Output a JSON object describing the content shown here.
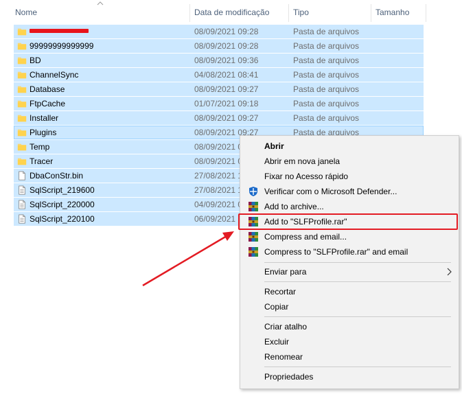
{
  "columns": {
    "name": "Nome",
    "date": "Data de modificação",
    "type": "Tipo",
    "size": "Tamanho"
  },
  "files": [
    {
      "name": "",
      "redacted": true,
      "date": "08/09/2021 09:28",
      "type": "Pasta de arquivos",
      "icon": "folder-icon"
    },
    {
      "name": "99999999999999",
      "date": "08/09/2021 09:28",
      "type": "Pasta de arquivos",
      "icon": "folder-icon"
    },
    {
      "name": "BD",
      "date": "08/09/2021 09:36",
      "type": "Pasta de arquivos",
      "icon": "folder-icon"
    },
    {
      "name": "ChannelSync",
      "date": "04/08/2021 08:41",
      "type": "Pasta de arquivos",
      "icon": "folder-icon"
    },
    {
      "name": "Database",
      "date": "08/09/2021 09:27",
      "type": "Pasta de arquivos",
      "icon": "folder-icon"
    },
    {
      "name": "FtpCache",
      "date": "01/07/2021 09:18",
      "type": "Pasta de arquivos",
      "icon": "folder-icon"
    },
    {
      "name": "Installer",
      "date": "08/09/2021 09:27",
      "type": "Pasta de arquivos",
      "icon": "folder-icon"
    },
    {
      "name": "Plugins",
      "date": "08/09/2021 09:27",
      "type": "Pasta de arquivos",
      "icon": "folder-icon"
    },
    {
      "name": "Temp",
      "date": "08/09/2021 0",
      "type": "",
      "icon": "folder-icon"
    },
    {
      "name": "Tracer",
      "date": "08/09/2021 0",
      "type": "",
      "icon": "folder-icon"
    },
    {
      "name": "DbaConStr.bin",
      "date": "27/08/2021 1",
      "type": "",
      "icon": "file-icon"
    },
    {
      "name": "SqlScript_219600",
      "date": "27/08/2021 1",
      "type": "",
      "icon": "text-file-icon"
    },
    {
      "name": "SqlScript_220000",
      "date": "04/09/2021 0",
      "type": "",
      "icon": "text-file-icon"
    },
    {
      "name": "SqlScript_220100",
      "date": "06/09/2021 1",
      "type": "",
      "icon": "text-file-icon"
    }
  ],
  "context_menu": {
    "open": "Abrir",
    "open_new_window": "Abrir em nova janela",
    "pin_quick_access": "Fixar no Acesso rápido",
    "defender_scan": "Verificar com o Microsoft Defender...",
    "add_to_archive": "Add to archive...",
    "add_to_rar": "Add to \"SLFProfile.rar\"",
    "compress_email": "Compress and email...",
    "compress_rar_email": "Compress to \"SLFProfile.rar\" and email",
    "send_to": "Enviar para",
    "cut": "Recortar",
    "copy": "Copiar",
    "create_shortcut": "Criar atalho",
    "delete": "Excluir",
    "rename": "Renomear",
    "properties": "Propriedades"
  },
  "colors": {
    "selection": "#cce8ff",
    "annotation": "#e31b23",
    "folder": "#f8d775"
  }
}
